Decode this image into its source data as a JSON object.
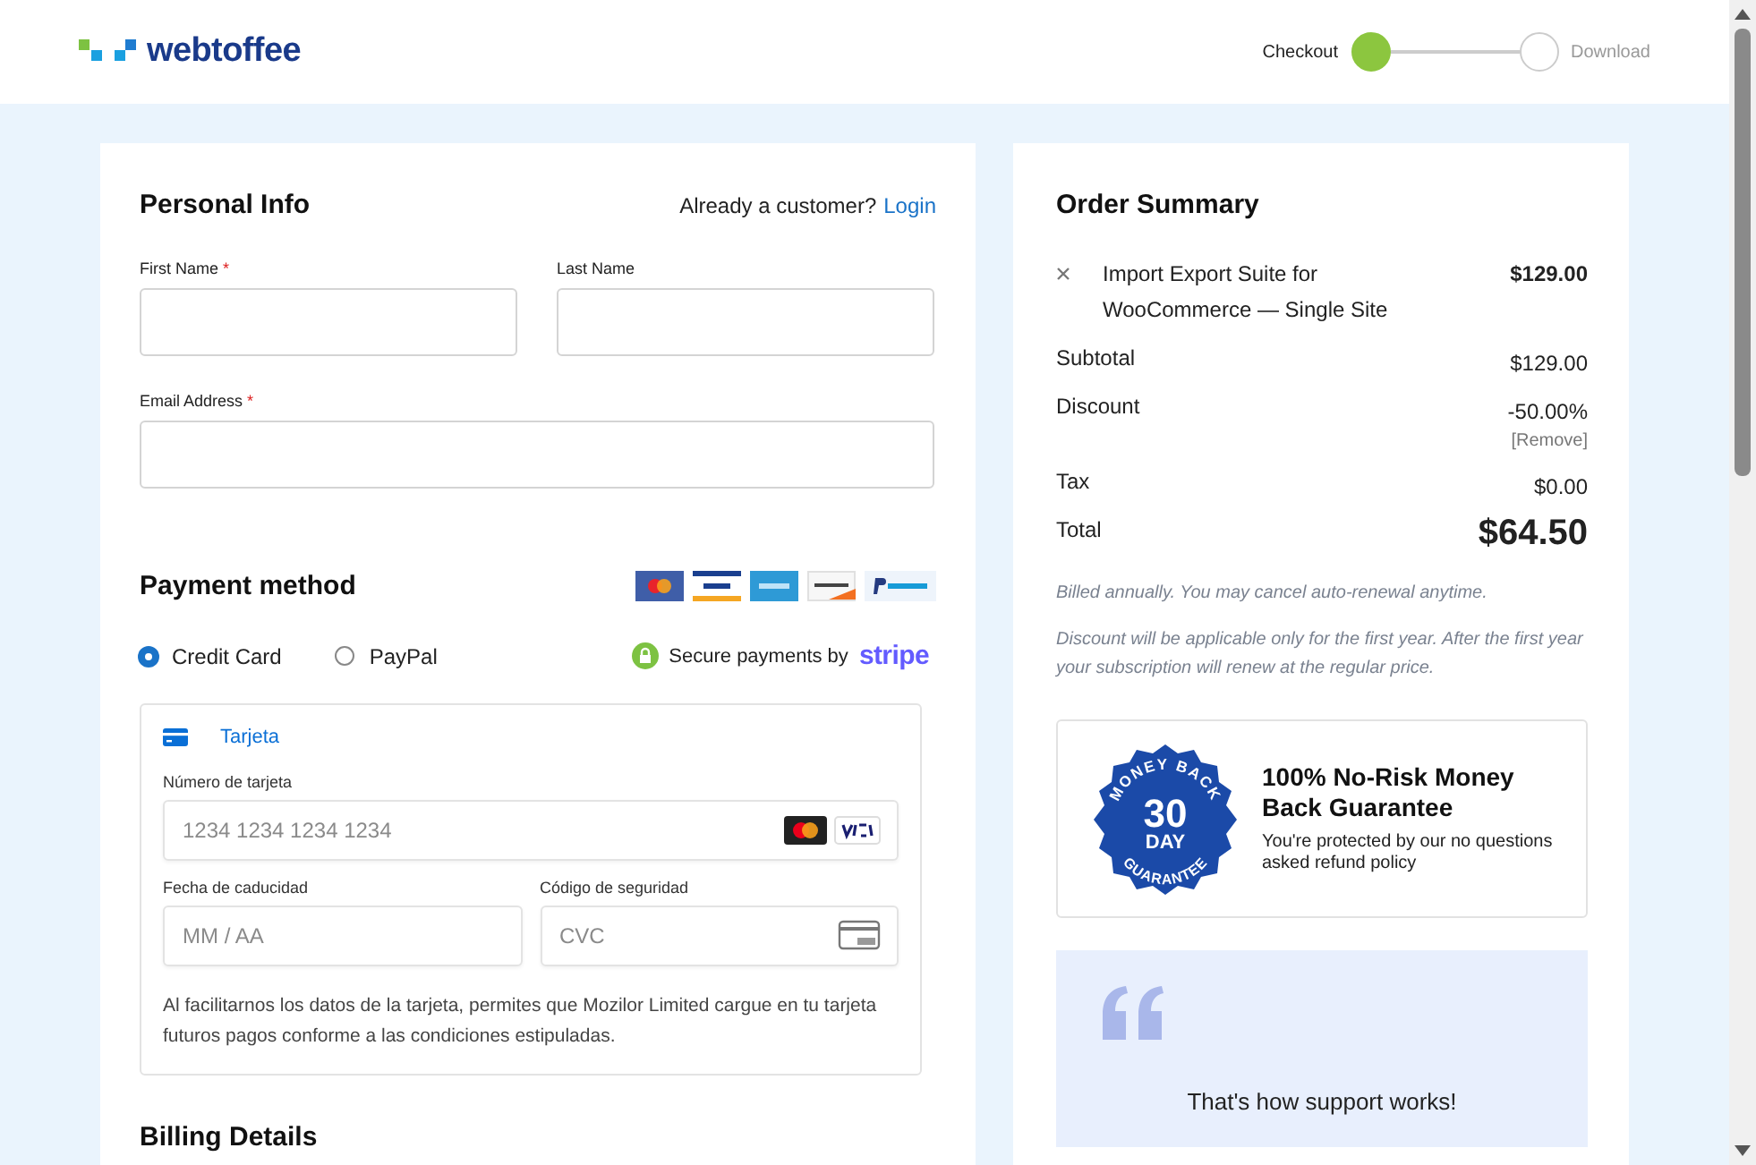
{
  "header": {
    "logo": "webtoffee",
    "steps": [
      {
        "label": "Checkout",
        "done": true
      },
      {
        "label": "Download",
        "done": false
      }
    ]
  },
  "personal_info": {
    "title": "Personal Info",
    "prompt": "Already a customer?",
    "login_link": "Login",
    "fields": [
      {
        "label": "First Name",
        "required_mark": "*"
      },
      {
        "label": "Last Name"
      },
      {
        "label": "Email Address",
        "required_mark": "*"
      }
    ]
  },
  "payment": {
    "title": "Payment method",
    "methods": [
      {
        "label": "Credit Card",
        "selected": true
      },
      {
        "label": "PayPal",
        "selected": false
      }
    ],
    "secure_text": "Secure payments by",
    "secure_brand": "stripe",
    "card_form": {
      "tab": "Tarjeta",
      "fields": [
        {
          "label": "Número de tarjeta",
          "placeholder": "1234 1234 1234 1234",
          "kind": "number"
        },
        {
          "label": "Fecha de caducidad",
          "placeholder": "MM / AA",
          "kind": "expiry"
        },
        {
          "label": "Código de seguridad",
          "placeholder": "CVC",
          "kind": "cvc"
        }
      ],
      "notice": "Al facilitarnos los datos de la tarjeta, permites que Mozilor Limited cargue en tu tarjeta futuros pagos conforme a las condiciones estipuladas."
    }
  },
  "billing": {
    "title": "Billing Details"
  },
  "order_summary": {
    "title": "Order Summary",
    "item": {
      "name": "Import Export Suite for WooCommerce — Single Site",
      "price": "$129.00"
    },
    "rows": [
      {
        "label": "Subtotal",
        "value": "$129.00",
        "kind": "plain"
      },
      {
        "label": "Discount",
        "value": "-50.00%",
        "kind": "discount",
        "action": "[Remove]"
      },
      {
        "label": "Tax",
        "value": "$0.00",
        "kind": "plain"
      },
      {
        "label": "Total",
        "value": "$64.50",
        "kind": "total"
      }
    ],
    "notes": [
      "Billed annually. You may cancel auto-renewal anytime.",
      "Discount will be applicable only for the first year. After the first year your subscription will renew at the regular price."
    ],
    "guarantee": {
      "badge_top": "MONEY BACK",
      "badge_number": "30",
      "badge_unit": "DAY",
      "badge_bottom": "GUARANTEE",
      "title": "100% No-Risk Money Back Guarantee",
      "text": "You're protected by our no questions asked refund policy"
    },
    "testimonial": {
      "text": "That's how support works!"
    }
  }
}
